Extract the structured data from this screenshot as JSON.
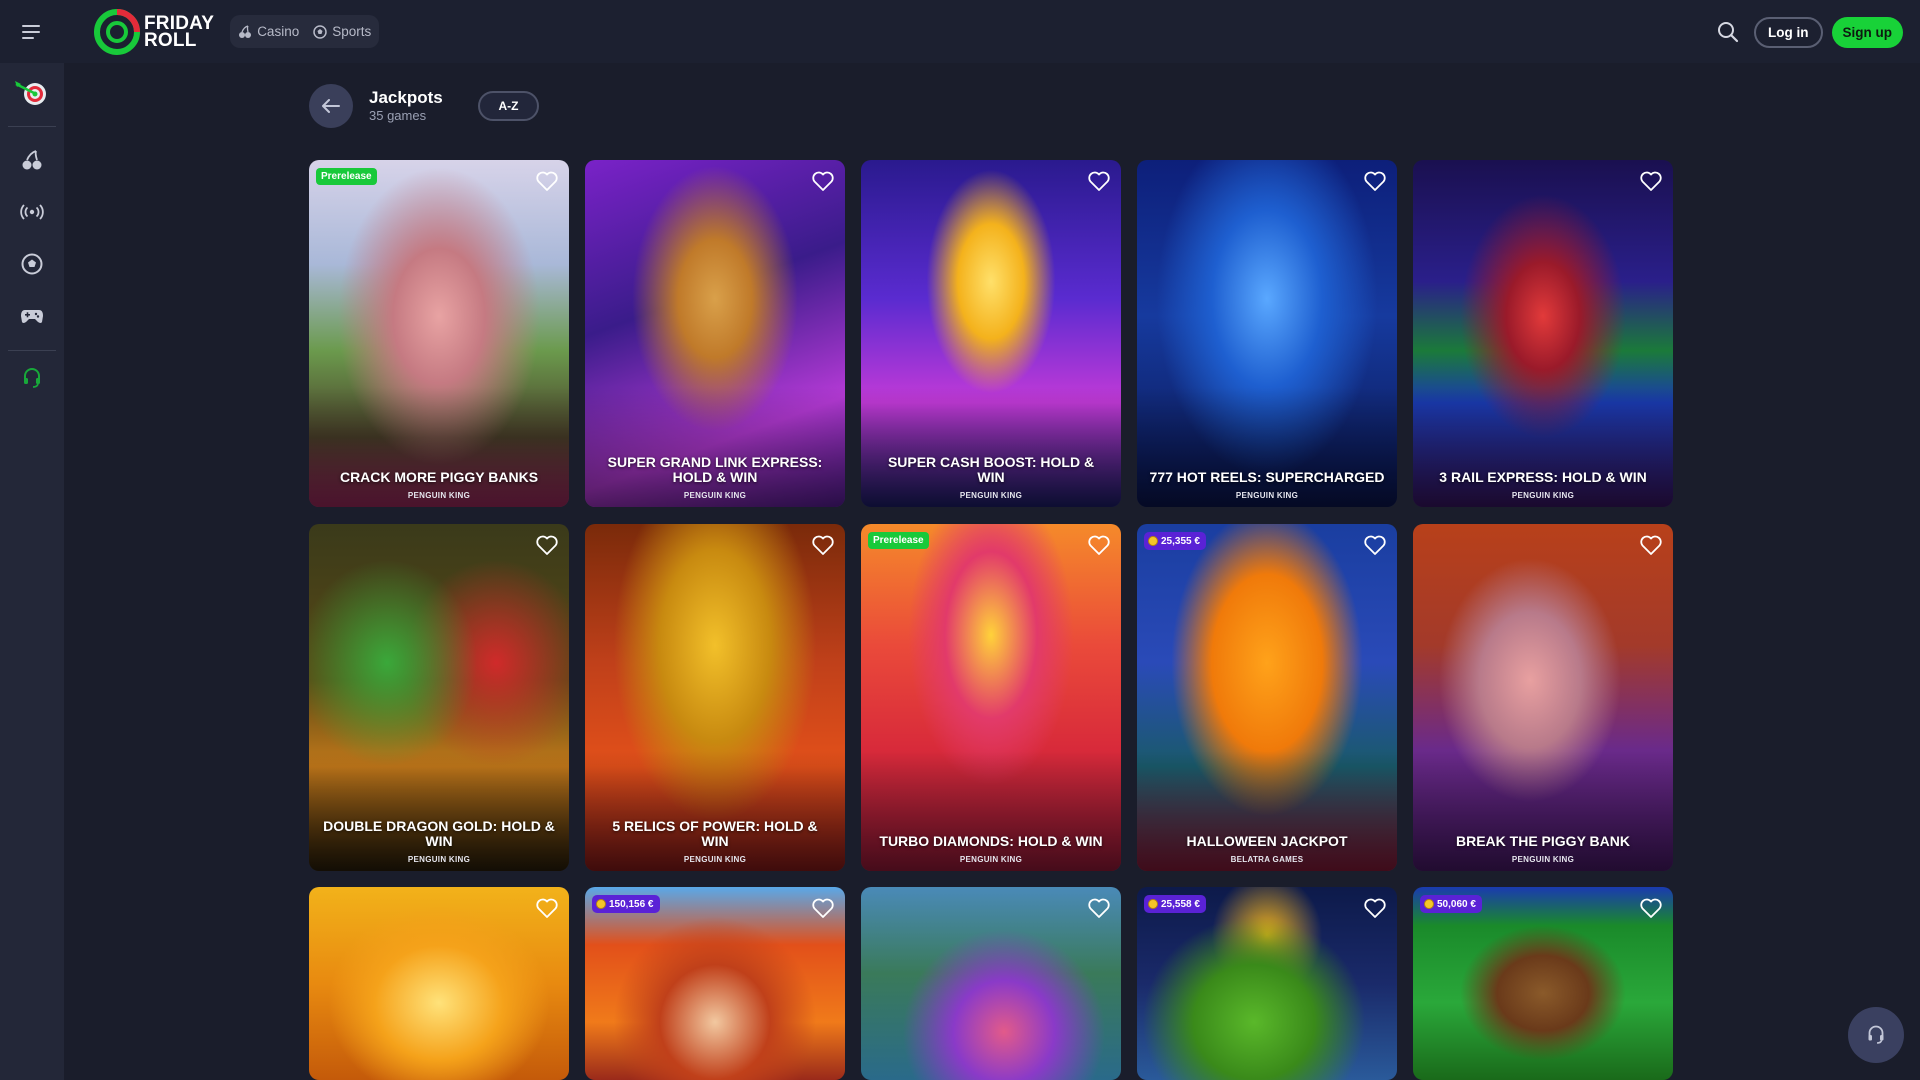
{
  "brand": {
    "line1": "FRIDAY",
    "line2": "ROLL"
  },
  "product_tabs": [
    {
      "label": "Casino",
      "icon": "cherries-icon"
    },
    {
      "label": "Sports",
      "icon": "football-icon"
    }
  ],
  "header_actions": {
    "login": "Log in",
    "signup": "Sign up"
  },
  "sidebar": {
    "items": [
      "dart-board-icon",
      "cherries-icon",
      "live-broadcast-icon",
      "football-icon",
      "gamepad-icon",
      "support-headset-icon"
    ]
  },
  "category": {
    "title": "Jackpots",
    "count": "35 games",
    "sort": "A-Z"
  },
  "colors": {
    "accent_green": "#18d238",
    "jackpot_badge": "#5a22d6",
    "background": "#1a1d2b"
  },
  "games": [
    {
      "title": "CRACK MORE PIGGY BANKS",
      "provider": "PENGUIN KING",
      "badge": "Prerelease",
      "jackpot": ""
    },
    {
      "title": "SUPER GRAND LINK EXPRESS: HOLD & WIN",
      "provider": "PENGUIN KING",
      "badge": "",
      "jackpot": ""
    },
    {
      "title": "SUPER CASH BOOST: HOLD & WIN",
      "provider": "PENGUIN KING",
      "badge": "",
      "jackpot": ""
    },
    {
      "title": "777 HOT REELS: SUPERCHARGED",
      "provider": "PENGUIN KING",
      "badge": "",
      "jackpot": ""
    },
    {
      "title": "3 RAIL EXPRESS: HOLD & WIN",
      "provider": "PENGUIN KING",
      "badge": "",
      "jackpot": ""
    },
    {
      "title": "DOUBLE DRAGON GOLD: HOLD & WIN",
      "provider": "PENGUIN KING",
      "badge": "",
      "jackpot": ""
    },
    {
      "title": "5 RELICS OF POWER: HOLD & WIN",
      "provider": "PENGUIN KING",
      "badge": "",
      "jackpot": ""
    },
    {
      "title": "TURBO DIAMONDS: HOLD & WIN",
      "provider": "PENGUIN KING",
      "badge": "Prerelease",
      "jackpot": ""
    },
    {
      "title": "HALLOWEEN JACKPOT",
      "provider": "BELATRA GAMES",
      "badge": "",
      "jackpot": "25,355 €"
    },
    {
      "title": "BREAK THE PIGGY BANK",
      "provider": "PENGUIN KING",
      "badge": "",
      "jackpot": ""
    },
    {
      "title": "",
      "provider": "",
      "badge": "",
      "jackpot": ""
    },
    {
      "title": "",
      "provider": "",
      "badge": "",
      "jackpot": "150,156 €"
    },
    {
      "title": "",
      "provider": "",
      "badge": "",
      "jackpot": ""
    },
    {
      "title": "",
      "provider": "",
      "badge": "",
      "jackpot": "25,558 €"
    },
    {
      "title": "",
      "provider": "",
      "badge": "",
      "jackpot": "50,060 €"
    }
  ]
}
